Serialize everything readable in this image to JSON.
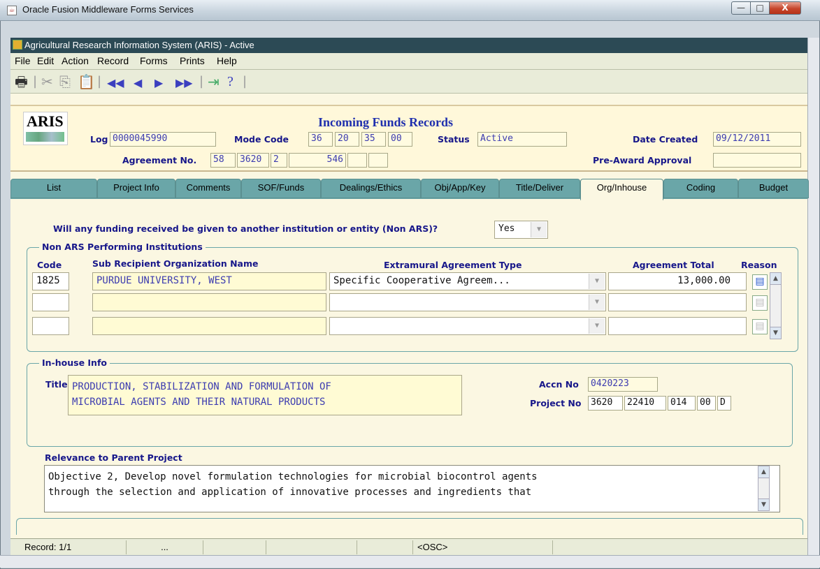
{
  "window": {
    "title": "Oracle Fusion Middleware Forms Services",
    "min_label": "—",
    "max_label": "□",
    "close_label": "X"
  },
  "app": {
    "title": "Agricultural Research Information System (ARIS) - Active"
  },
  "menu": [
    "File",
    "Edit",
    "Action",
    "Record",
    "Forms",
    "Prints",
    "Help"
  ],
  "toolbar_icons": [
    "print-icon",
    "cut-icon",
    "copy-icon",
    "paste-icon",
    "first-record-icon",
    "previous-record-icon",
    "next-record-icon",
    "last-record-icon",
    "exit-icon",
    "help-icon"
  ],
  "header": {
    "logo_text": "ARIS",
    "page_title": "Incoming Funds Records",
    "log_label": "Log",
    "log_value": "0000045990",
    "mode_code_label": "Mode Code",
    "mode_code": [
      "36",
      "20",
      "35",
      "00"
    ],
    "status_label": "Status",
    "status_value": "Active",
    "date_created_label": "Date Created",
    "date_created_value": "09/12/2011",
    "agreement_label": "Agreement No.",
    "agreement": [
      "58",
      "3620",
      "2",
      "546",
      "",
      ""
    ],
    "preaward_label": "Pre-Award Approval",
    "preaward_value": ""
  },
  "tabs": [
    "List",
    "Project Info",
    "Comments",
    "SOF/Funds",
    "Dealings/Ethics",
    "Obj/App/Key",
    "Title/Deliver",
    "Org/Inhouse",
    "Coding",
    "Budget"
  ],
  "active_tab": "Org/Inhouse",
  "question": {
    "text": "Will any funding received be given to another institution or entity (Non ARS)?",
    "answer": "Yes"
  },
  "non_ars": {
    "title": "Non ARS Performing Institutions",
    "headers": {
      "code": "Code",
      "name": "Sub Recipient Organization Name",
      "type": "Extramural Agreement Type",
      "total": "Agreement Total",
      "reason": "Reason"
    },
    "rows": [
      {
        "code": "1825",
        "name": "PURDUE UNIVERSITY, WEST",
        "type": "Specific Cooperative Agreem...",
        "total": "13,000.00"
      },
      {
        "code": "",
        "name": "",
        "type": "",
        "total": ""
      },
      {
        "code": "",
        "name": "",
        "type": "",
        "total": ""
      }
    ]
  },
  "inhouse": {
    "title": "In-house Info",
    "title_label": "Title",
    "title_lines": [
      "PRODUCTION, STABILIZATION AND FORMULATION OF",
      "MICROBIAL AGENTS AND THEIR NATURAL PRODUCTS"
    ],
    "accn_label": "Accn No",
    "accn_value": "0420223",
    "project_label": "Project No",
    "project": [
      "3620",
      "22410",
      "014",
      "00",
      "D"
    ]
  },
  "relevance": {
    "label": "Relevance to Parent Project",
    "lines": [
      "Objective 2, Develop novel formulation technologies for microbial biocontrol agents",
      "through the selection and application of innovative processes and ingredients that"
    ]
  },
  "status_bar": {
    "record": "Record: 1/1",
    "ellipsis": "...",
    "osc": "<OSC>"
  }
}
